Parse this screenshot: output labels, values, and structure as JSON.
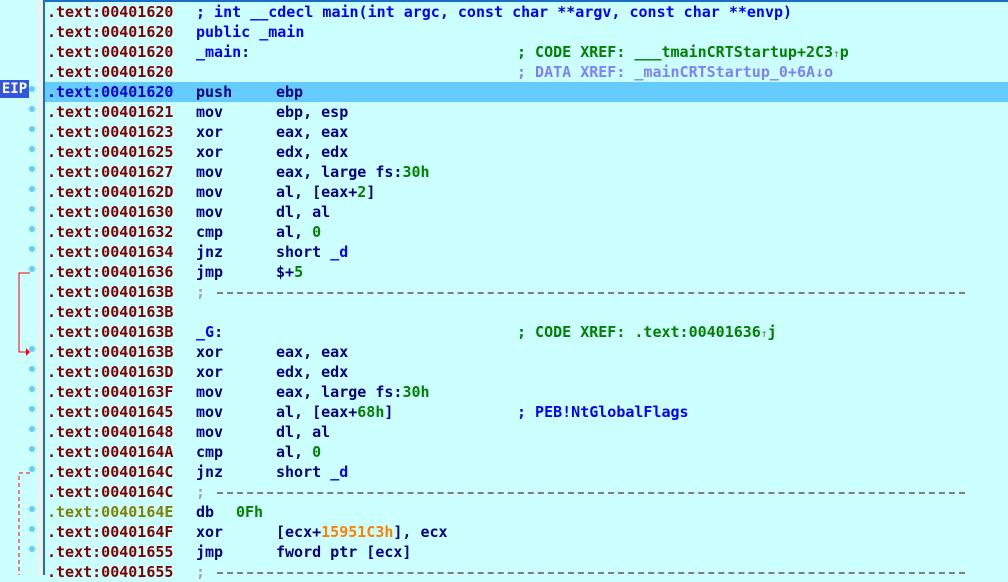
{
  "eip_label": "EIP",
  "lines": [
    {
      "addr": ".text:00401620",
      "type": "comment",
      "text": "; int __cdecl main(int argc, const char **argv, const char **envp)"
    },
    {
      "addr": ".text:00401620",
      "type": "raw",
      "text": "public _main"
    },
    {
      "addr": ".text:00401620",
      "type": "label",
      "label": "_main",
      "xref_kind": "; CODE XREF: ",
      "xref_target": "___tmainCRTStartup+2C3",
      "xref_dir": "↑",
      "xref_type": "p"
    },
    {
      "addr": ".text:00401620",
      "type": "xref_data",
      "xref_kind": "; DATA XREF: ",
      "xref_target": "_mainCRTStartup_0+6A",
      "xref_dir": "↓",
      "xref_type": "o"
    },
    {
      "addr": ".text:00401620",
      "mnemonic": "push",
      "operand": "ebp",
      "current": true
    },
    {
      "addr": ".text:00401621",
      "mnemonic": "mov",
      "operand": "ebp, esp"
    },
    {
      "addr": ".text:00401623",
      "mnemonic": "xor",
      "operand": "eax, eax"
    },
    {
      "addr": ".text:00401625",
      "mnemonic": "xor",
      "operand": "edx, edx"
    },
    {
      "addr": ".text:00401627",
      "mnemonic": "mov",
      "operand": "eax, large fs:",
      "operand_num": "30h"
    },
    {
      "addr": ".text:0040162D",
      "mnemonic": "mov",
      "operand": "al, [eax+",
      "operand_num": "2",
      "operand_tail": "]"
    },
    {
      "addr": ".text:00401630",
      "mnemonic": "mov",
      "operand": "dl, al"
    },
    {
      "addr": ".text:00401632",
      "mnemonic": "cmp",
      "operand": "al, ",
      "operand_num": "0"
    },
    {
      "addr": ".text:00401634",
      "mnemonic": "jnz",
      "operand": "short ",
      "operand_label": "_d"
    },
    {
      "addr": ".text:00401636",
      "mnemonic": "jmp",
      "operand": "$+",
      "operand_num": "5"
    },
    {
      "addr": ".text:0040163B",
      "type": "separator",
      "text": ";"
    },
    {
      "addr": ".text:0040163B",
      "type": "empty"
    },
    {
      "addr": ".text:0040163B",
      "type": "label",
      "label": "_G",
      "xref_kind": "; CODE XREF: ",
      "xref_target": ".text:00401636",
      "xref_dir": "↑",
      "xref_type": "j"
    },
    {
      "addr": ".text:0040163B",
      "mnemonic": "xor",
      "operand": "eax, eax"
    },
    {
      "addr": ".text:0040163D",
      "mnemonic": "xor",
      "operand": "edx, edx"
    },
    {
      "addr": ".text:0040163F",
      "mnemonic": "mov",
      "operand": "eax, large fs:",
      "operand_num": "30h"
    },
    {
      "addr": ".text:00401645",
      "mnemonic": "mov",
      "operand": "al, [eax+",
      "operand_num": "68h",
      "operand_tail": "]",
      "comment": "; PEB!NtGlobalFlags"
    },
    {
      "addr": ".text:00401648",
      "mnemonic": "mov",
      "operand": "dl, al"
    },
    {
      "addr": ".text:0040164A",
      "mnemonic": "cmp",
      "operand": "al, ",
      "operand_num": "0"
    },
    {
      "addr": ".text:0040164C",
      "mnemonic": "jnz",
      "operand": "short ",
      "operand_label": "_d"
    },
    {
      "addr": ".text:0040164C",
      "type": "separator",
      "text": ";"
    },
    {
      "addr": ".text:0040164E",
      "type": "data",
      "mnemonic": "db",
      "operand_num": "0Fh"
    },
    {
      "addr": ".text:0040164F",
      "mnemonic": "xor",
      "operand": "[ecx+",
      "operand_imm": "15951C3h",
      "operand_tail": "], ecx"
    },
    {
      "addr": ".text:00401655",
      "mnemonic": "jmp",
      "operand": "fword ptr [ecx]"
    },
    {
      "addr": ".text:00401655",
      "type": "separator",
      "text": ";"
    }
  ],
  "colors": {
    "background": "#ccffff",
    "current_line": "#66ccff",
    "address": "#800000",
    "data_address": "#808000",
    "instruction": "#000080",
    "number": "#008000",
    "immediate": "#ff8000",
    "label": "#0000ff",
    "jump_arrow": "#ff0000"
  }
}
